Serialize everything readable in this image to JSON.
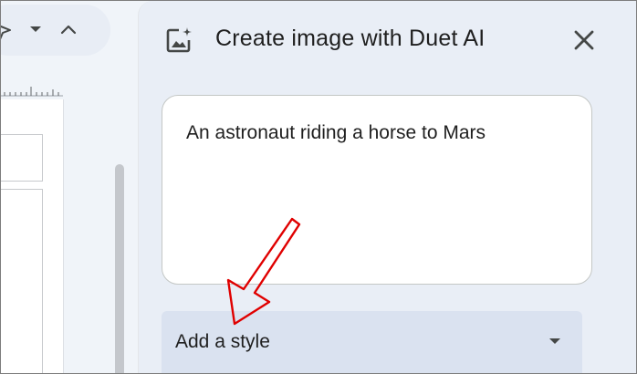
{
  "panel": {
    "title": "Create image with Duet AI",
    "prompt_value": "An astronaut riding a horse to Mars",
    "style_select": {
      "selected": "Add a style"
    }
  },
  "icons": {
    "title_icon": "image-sparkle-icon",
    "close": "close-icon",
    "toolbar_select": "pointer-select-icon",
    "toolbar_dropdown": "chevron-down-icon",
    "toolbar_collapse": "chevron-up-icon",
    "style_dropdown": "caret-down-icon"
  },
  "colors": {
    "panel_bg": "#e9eef6",
    "select_bg": "#dae2f0",
    "annotation": "#e00000",
    "text": "#1f1f1f"
  }
}
